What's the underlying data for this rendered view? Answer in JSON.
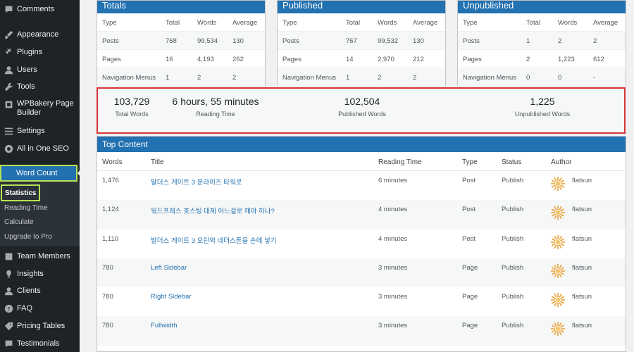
{
  "sidebar": {
    "items": [
      {
        "label": "Comments",
        "icon": "comments-icon"
      },
      {
        "label": "Appearance",
        "icon": "appearance-icon"
      },
      {
        "label": "Plugins",
        "icon": "plugins-icon"
      },
      {
        "label": "Users",
        "icon": "users-icon"
      },
      {
        "label": "Tools",
        "icon": "tools-icon"
      },
      {
        "label": "WPBakery Page",
        "label2": "Builder",
        "icon": "wpbakery-icon"
      },
      {
        "label": "Settings",
        "icon": "settings-icon"
      },
      {
        "label": "All in One SEO",
        "icon": "seo-icon"
      },
      {
        "label": "Word Count",
        "icon": ""
      },
      {
        "label": "Team Members",
        "icon": "team-icon"
      },
      {
        "label": "Insights",
        "icon": "insights-icon"
      },
      {
        "label": "Clients",
        "icon": "clients-icon"
      },
      {
        "label": "FAQ",
        "icon": "faq-icon"
      },
      {
        "label": "Pricing Tables",
        "icon": "pricing-icon"
      },
      {
        "label": "Testimonials",
        "icon": "testimonials-icon"
      }
    ],
    "submenu": [
      "Statistics",
      "Reading Time",
      "Calculate",
      "Upgrade to Pro"
    ]
  },
  "panels": [
    {
      "title": "Totals",
      "headers": [
        "Type",
        "Total",
        "Words",
        "Average"
      ],
      "rows": [
        [
          "Posts",
          "768",
          "99,534",
          "130"
        ],
        [
          "Pages",
          "16",
          "4,193",
          "262"
        ],
        [
          "Navigation Menus",
          "1",
          "2",
          "2"
        ]
      ]
    },
    {
      "title": "Published",
      "headers": [
        "Type",
        "Total",
        "Words",
        "Average"
      ],
      "rows": [
        [
          "Posts",
          "767",
          "99,532",
          "130"
        ],
        [
          "Pages",
          "14",
          "2,970",
          "212"
        ],
        [
          "Navigation Menus",
          "1",
          "2",
          "2"
        ]
      ]
    },
    {
      "title": "Unpublished",
      "headers": [
        "Type",
        "Total",
        "Words",
        "Average"
      ],
      "rows": [
        [
          "Posts",
          "1",
          "2",
          "2"
        ],
        [
          "Pages",
          "2",
          "1,223",
          "612"
        ],
        [
          "Navigation Menus",
          "0",
          "0",
          "-"
        ]
      ]
    }
  ],
  "stats": [
    {
      "value": "103,729",
      "label": "Total Words"
    },
    {
      "value": "6 hours, 55 minutes",
      "label": "Reading Time"
    },
    {
      "value": "102,504",
      "label": "Published Words"
    },
    {
      "value": "1,225",
      "label": "Unpublished Words"
    }
  ],
  "top_content": {
    "title": "Top Content",
    "headers": [
      "Words",
      "Title",
      "Reading Time",
      "Type",
      "Status",
      "Author"
    ],
    "rows": [
      [
        "1,476",
        "발더스 게이트 3 문라이즈 타워로",
        "6 minutes",
        "Post",
        "Publish",
        "flatsun"
      ],
      [
        "1,124",
        "워드프레스 호스팅 대체 어느걸로 해야 하나?",
        "4 minutes",
        "Post",
        "Publish",
        "flatsun"
      ],
      [
        "1,110",
        "발더스 게이트 3 오린의 네더스톤을 손에 넣기",
        "4 minutes",
        "Post",
        "Publish",
        "flatsun"
      ],
      [
        "780",
        "Left Sidebar",
        "3 minutes",
        "Page",
        "Publish",
        "flatsun"
      ],
      [
        "780",
        "Right Sidebar",
        "3 minutes",
        "Page",
        "Publish",
        "flatsun"
      ],
      [
        "780",
        "Fullwidth",
        "3 minutes",
        "Page",
        "Publish",
        "flatsun"
      ]
    ]
  },
  "colors": {
    "sidebar": "#1d2327",
    "accent": "#2271b1",
    "highlight": "#b6e356",
    "stats_border": "#d63638"
  }
}
